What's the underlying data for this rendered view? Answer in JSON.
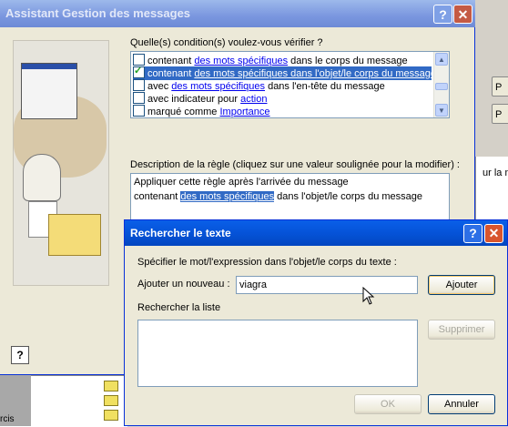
{
  "background": {
    "side_text": "ur la mo",
    "side_buttons": [
      "P",
      "P"
    ],
    "bottom_text": "rcis"
  },
  "wizard": {
    "title": "Assistant Gestion des messages",
    "conditions_label": "Quelle(s) condition(s) voulez-vous vérifier ?",
    "conditions": [
      {
        "checked": false,
        "selected": false,
        "pre": "contenant ",
        "link": "des mots spécifiques",
        "post": " dans le corps du message"
      },
      {
        "checked": true,
        "selected": true,
        "pre": "contenant ",
        "link": "des mots spécifiques dans l'objet/le corps du message",
        "post": ""
      },
      {
        "checked": false,
        "selected": false,
        "pre": "avec ",
        "link": "des mots spécifiques",
        "post": " dans l'en-tête du message"
      },
      {
        "checked": false,
        "selected": false,
        "pre": "avec indicateur pour ",
        "link": "action",
        "post": ""
      },
      {
        "checked": false,
        "selected": false,
        "pre": "marqué comme ",
        "link": "Importance",
        "post": ""
      }
    ],
    "description_label": "Description de la règle (cliquez sur une valeur soulignée pour la modifier) :",
    "description_line1": "Appliquer cette règle après l'arrivée du message",
    "description_pre": "contenant ",
    "description_link": "des mots spécifiques",
    "description_post": " dans l'objet/le corps du message",
    "help_glyph": "?"
  },
  "dialog": {
    "title": "Rechercher le texte",
    "instruction": "Spécifier le mot/l'expression dans l'objet/le corps du texte :",
    "add_label": "Ajouter un nouveau :",
    "input_value": "viagra",
    "add_button": "Ajouter",
    "list_label": "Rechercher la liste",
    "remove_button": "Supprimer",
    "ok_button": "OK",
    "cancel_button": "Annuler"
  },
  "titlebar_glyphs": {
    "help": "?",
    "close": "✕"
  },
  "colors": {
    "selection": "#316ac5",
    "link": "#0000ee",
    "dialog_title": "#0553d8"
  }
}
